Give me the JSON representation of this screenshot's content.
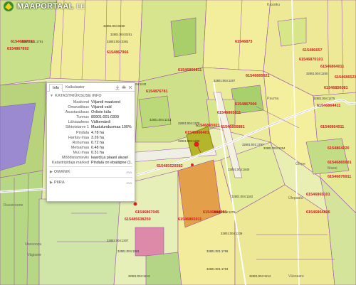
{
  "app": {
    "logo_text": "MAAPORTAAL",
    "logo_ext": "EE"
  },
  "panel": {
    "tabs": [
      "Info",
      "Kalkulaator"
    ],
    "section_title": "KATASTRIÜKSUSE INFO",
    "rows": [
      {
        "k": "Maakond",
        "v": "Viljandi maakond"
      },
      {
        "k": "Omavalitsus",
        "v": "Viljandi vald"
      },
      {
        "k": "Asustusüksus",
        "v": "Ovliste küla"
      },
      {
        "k": "Tunnus",
        "v": "89901:001:0309"
      },
      {
        "k": "Lähiaadress",
        "v": "Välkemärdi"
      },
      {
        "k": "Sihtotstarve 1",
        "v": "Maatulundusmaa 100%"
      },
      {
        "k": "Pindala",
        "v": "4.78 ha"
      },
      {
        "k": "Haritav maa",
        "v": "3.26 ha"
      },
      {
        "k": "Rohumaa",
        "v": "0.72 ha"
      },
      {
        "k": "Metsamaa",
        "v": "0.48 ha"
      },
      {
        "k": "Muu maa",
        "v": "0.31 ha"
      },
      {
        "k": "Mõõdistamisviis",
        "v": "kaardi ja plaani alusel"
      },
      {
        "k": "Katastripidaja märked",
        "v": "Pindala on ebatäpne (1..."
      }
    ],
    "omanik": {
      "title": "OMANIK",
      "link": "Ava"
    },
    "piira": {
      "title": "PIIRA",
      "link": "Ava"
    }
  },
  "map": {
    "red_labels": [
      "6154867892",
      "61546867911",
      "6154867966",
      "61546866811",
      "6154867000",
      "61546866401",
      "61546865921",
      "61546865811",
      "6154876781",
      "61546870101",
      "61546864011",
      "61546856081",
      "61546864411",
      "6154864220",
      "61546876911",
      "61546865101",
      "61546864896",
      "61546864951",
      "61546865911",
      "61546867045",
      "615485638250",
      "615485529382",
      "61546856881",
      "61546865921",
      "61546865231",
      "61546864011",
      "61546865901",
      "615486657",
      "61546873"
    ],
    "parcel_ids": [
      "32801:004:0260",
      "32801:004:0251",
      "32801:004:0281",
      "32801:004:1242",
      "32801:004:1207",
      "32801:004:1213",
      "32801:004:1250",
      "32801:004:1275",
      "32801:004:1270",
      "32801:004:1276",
      "32801:004:1183",
      "32801:004:1239",
      "32801:004:1207",
      "32801:004:1183",
      "32801:001:1793",
      "32801:001:1797",
      "32801:001:1766",
      "32801:004:1212",
      "32801:004:1213",
      "32801:004:1206",
      "32801:004:1254",
      "32801:001:1791",
      "32801:004:1840"
    ],
    "places": [
      "Kassiku",
      "Pauma",
      "Massi",
      "Vägisete",
      "Olepe",
      "Ülepaalu",
      "Usesoopu",
      "Ruuvisoone",
      "Vüssaare"
    ]
  }
}
